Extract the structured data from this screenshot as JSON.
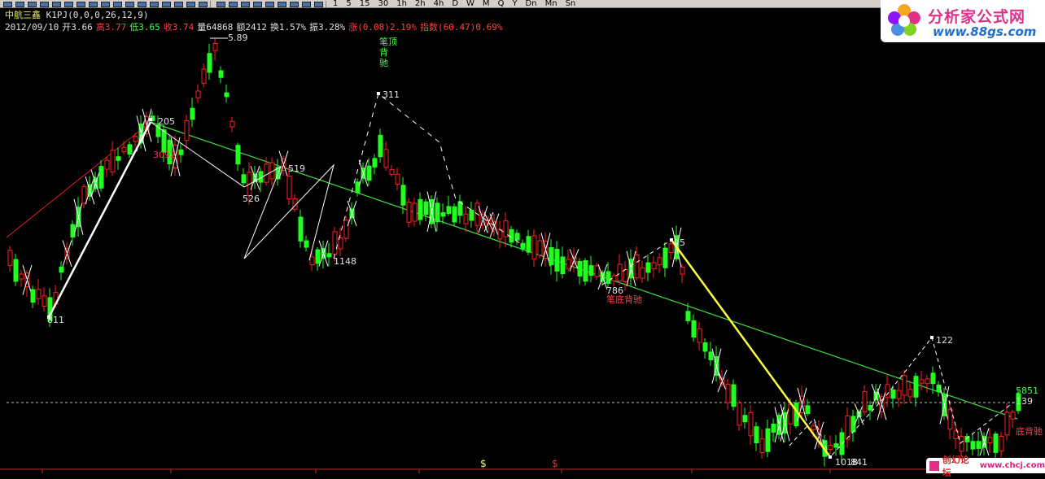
{
  "window": {
    "timeframes": [
      "1",
      "5",
      "15",
      "30",
      "1h",
      "2h",
      "4h",
      "D",
      "W",
      "M",
      "Q",
      "Y",
      "Dn",
      "Mn",
      "Sn"
    ]
  },
  "header": {
    "stock": "中航三鑫",
    "indicator": "K1PJ(0,0,0,26,12,9)",
    "date": "2012/09/10",
    "open": "开3.66",
    "high": "高3.77",
    "low": "低3.65",
    "close": "收3.74",
    "volume": "量64868",
    "amount": "额2412",
    "turnover": "换1.57%",
    "amplitude": "振3.28%",
    "change": "涨(0.08)2.19%",
    "index": "指数(60.47)0.69%"
  },
  "logo": {
    "name": "分析家公式网",
    "url": "www.88gs.com"
  },
  "footer_mark": {
    "text": "创幻论坛",
    "url": "www.chcj.com"
  },
  "colors": {
    "up": "#ff2020",
    "down": "#20ff20",
    "trend": "#40e040",
    "stroke": "#ffffff",
    "highlight": "#ffff40"
  },
  "chart_data": {
    "type": "candlestick",
    "labels": [
      {
        "text": "5.89",
        "color": "#e0e0e0"
      },
      {
        "text": "笔顶",
        "color": "#40ff40"
      },
      {
        "text": "背",
        "color": "#40ff40"
      },
      {
        "text": "驰",
        "color": "#40ff40"
      },
      {
        "text": "311",
        "color": "#e0e0e0"
      },
      {
        "text": "205",
        "color": "#e0e0e0"
      },
      {
        "text": "3092",
        "color": "#ff4040"
      },
      {
        "text": "519",
        "color": "#e0e0e0"
      },
      {
        "text": "526",
        "color": "#e0e0e0"
      },
      {
        "text": "1148",
        "color": "#e0e0e0"
      },
      {
        "text": "811",
        "color": "#e0e0e0"
      },
      {
        "text": "25",
        "color": "#e0e0e0"
      },
      {
        "text": "786",
        "color": "#e0e0e0"
      },
      {
        "text": "笔底背驰",
        "color": "#ff4040"
      },
      {
        "text": "122",
        "color": "#e0e0e0"
      },
      {
        "text": "5851",
        "color": "#40ff40"
      },
      {
        "text": "139",
        "color": "#e0e0e0"
      },
      {
        "text": "底背驰",
        "color": "#ff4040"
      },
      {
        "text": "1018",
        "color": "#e0e0e0"
      },
      {
        "text": "841",
        "color": "#e0e0e0"
      }
    ],
    "axis_marks": [
      {
        "text": "$",
        "color": "#ffff40"
      },
      {
        "text": "$",
        "color": "#ff3030"
      }
    ]
  }
}
